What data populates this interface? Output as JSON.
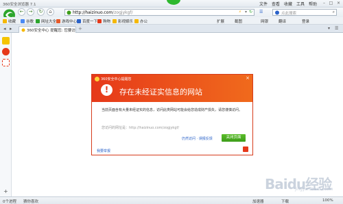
{
  "window": {
    "title": "360安全浏览器 7.1",
    "menu": [
      "文件",
      "查看",
      "收藏",
      "工具",
      "帮助"
    ]
  },
  "address_bar": {
    "url_host": "http://haizinuo.com",
    "url_path": "/zogjykgf/",
    "search_placeholder": "点此搜索"
  },
  "favorites": [
    {
      "label": "收藏",
      "color": "#f5b800"
    },
    {
      "label": "谷歌",
      "color": "#4a8af4"
    },
    {
      "label": "网址大全",
      "color": "#2da52d"
    },
    {
      "label": "游戏中心",
      "color": "#e65a2a"
    },
    {
      "label": "百度一下",
      "color": "#2a62c9"
    },
    {
      "label": "购物",
      "color": "#e6391a"
    },
    {
      "label": "影视娱乐",
      "color": "#f5b800"
    },
    {
      "label": "办公",
      "color": "#f5b800"
    }
  ],
  "toolbar_right": [
    "扩展",
    "截图",
    "网银",
    "翻译",
    "登录"
  ],
  "tab": {
    "label": "360安全中心 提醒您: 您要访"
  },
  "dialog": {
    "brand": "360安全中心提醒您",
    "heading": "存在未经证实信息的网站",
    "description": "当前页面含有大量未经证实的信息，访问此类网站可能会给您造成财产损失，请您谨慎访问。",
    "url_label": "您访问的网址是：http://haizinuo.com/zogjykgf/",
    "links": "仍然访问 · 误报反馈",
    "close_button": "关闭页面",
    "more_link": "我要举报"
  },
  "statusbar": {
    "left": "0个进程",
    "left2": "猜你喜欢",
    "right": [
      "加速器",
      "下载",
      "100%"
    ]
  },
  "watermark": {
    "text": "Baidu经验",
    "sub": "jingyan.baidu.com"
  }
}
